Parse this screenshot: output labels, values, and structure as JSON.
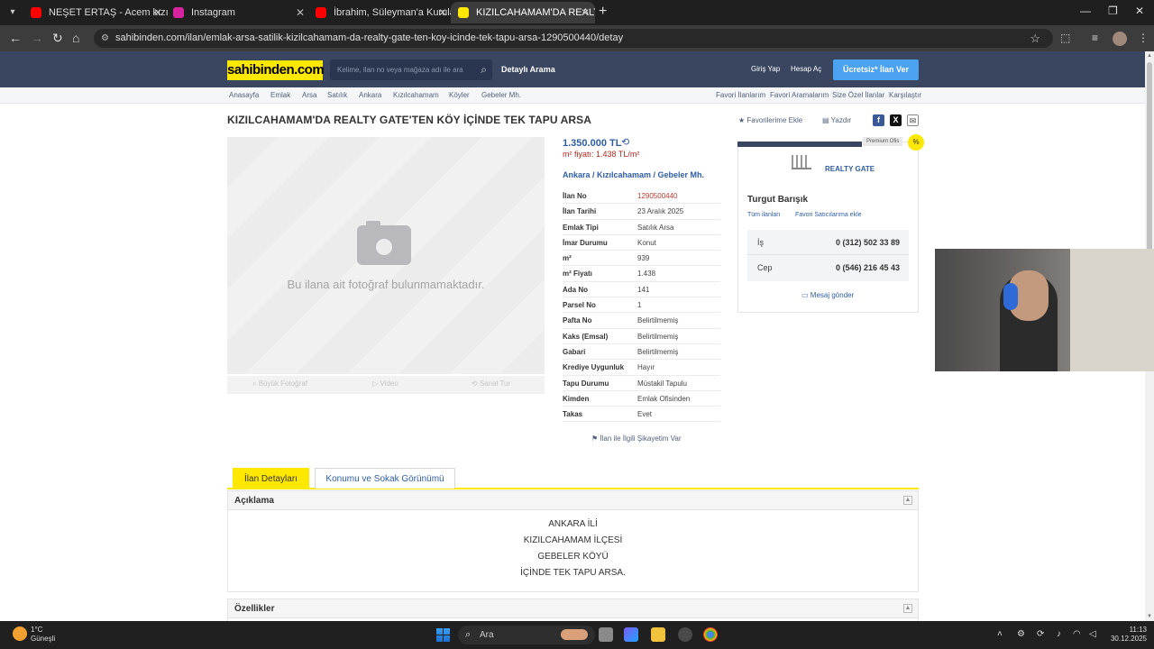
{
  "browser": {
    "tabs": [
      {
        "title": "NEŞET ERTAŞ - Acem kızı, Çırpın",
        "icon": "youtube-icon",
        "color": "#ff0000"
      },
      {
        "title": "Instagram",
        "icon": "instagram-icon",
        "color": "#d6249f"
      },
      {
        "title": "İbrahim, Süleyman'a Kurulan Su",
        "icon": "youtube-icon",
        "color": "#ff0000"
      },
      {
        "title": "KIZILCAHAMAM'DA REALTY GA",
        "icon": "sahibinden-icon",
        "color": "#ffe800"
      }
    ],
    "url": "sahibinden.com/ilan/emlak-arsa-satilik-kizilcahamam-da-realty-gate-ten-koy-icinde-tek-tapu-arsa-1290500440/detay"
  },
  "header": {
    "logo": "sahibinden.com",
    "search_placeholder": "Kelime, ilan no veya mağaza adı ile ara",
    "detailed_search": "Detaylı Arama",
    "login": "Giriş Yap",
    "register": "Hesap Aç",
    "post_ad": "Ücretsiz* İlan Ver"
  },
  "breadcrumb": {
    "items": [
      "Anasayfa",
      "Emlak",
      "Arsa",
      "Satılık",
      "Ankara",
      "Kızılcahamam",
      "Köyler",
      "Gebeler Mh."
    ],
    "right_links": [
      "Favori İlanlarım",
      "Favori Aramalarım",
      "Size Özel İlanlar",
      "Karşılaştır"
    ]
  },
  "listing": {
    "title": "KIZILCAHAMAM'DA REALTY GATE'TEN KÖY İÇİNDE TEK TAPU ARSA",
    "add_favorite": "Favorilerime Ekle",
    "print": "Yazdır",
    "no_photo": "Bu ilana ait fotoğraf bulunmamaktadır.",
    "photo_tabs": [
      "Büyük Fotoğraf",
      "Video",
      "Sanal Tur"
    ],
    "price": "1.350.000 TL",
    "m2_price": "m² fiyatı: 1.438 TL/m²",
    "location": "Ankara  /  Kızılcahamam  /  Gebeler Mh.",
    "details": [
      {
        "k": "İlan No",
        "v": "1290500440"
      },
      {
        "k": "İlan Tarihi",
        "v": "23 Aralık 2025"
      },
      {
        "k": "Emlak Tipi",
        "v": "Satılık Arsa"
      },
      {
        "k": "İmar Durumu",
        "v": "Konut"
      },
      {
        "k": "m²",
        "v": "939"
      },
      {
        "k": "m² Fiyatı",
        "v": "1.438"
      },
      {
        "k": "Ada No",
        "v": "141"
      },
      {
        "k": "Parsel No",
        "v": "1"
      },
      {
        "k": "Pafta No",
        "v": "Belirtilmemiş"
      },
      {
        "k": "Kaks (Emsal)",
        "v": "Belirtilmemiş"
      },
      {
        "k": "Gabari",
        "v": "Belirtilmemiş"
      },
      {
        "k": "Krediye Uygunluk",
        "v": "Hayır"
      },
      {
        "k": "Tapu Durumu",
        "v": "Müstakil Tapulu"
      },
      {
        "k": "Kimden",
        "v": "Emlak Ofisinden"
      },
      {
        "k": "Takas",
        "v": "Evet"
      }
    ],
    "complaint": "İlan ile İlgili Şikayetim Var"
  },
  "seller": {
    "premium": "Premium Ofis",
    "brand": "REALTY GATE",
    "name": "Turgut Barışık",
    "all_ads": "Tüm ilanları",
    "fav_seller": "Favori Satıcılarıma ekle",
    "work_label": "İş",
    "work_phone": "0 (312) 502 33 89",
    "mobile_label": "Cep",
    "mobile_phone": "0 (546) 216 45 43",
    "message": "Mesaj gönder"
  },
  "tabs": [
    "İlan Detayları",
    "Konumu ve Sokak Görünümü"
  ],
  "description": {
    "heading": "Açıklama",
    "lines": [
      "ANKARA İLİ",
      "KIZILCAHAMAM İLÇESİ",
      "GEBELER KÖYÜ",
      "İÇİNDE TEK TAPU ARSA."
    ]
  },
  "features_heading": "Özellikler",
  "taskbar": {
    "temp": "1°C",
    "weather": "Güneşli",
    "search": "Ara",
    "time": "11:13",
    "date": "30.12.2025"
  }
}
